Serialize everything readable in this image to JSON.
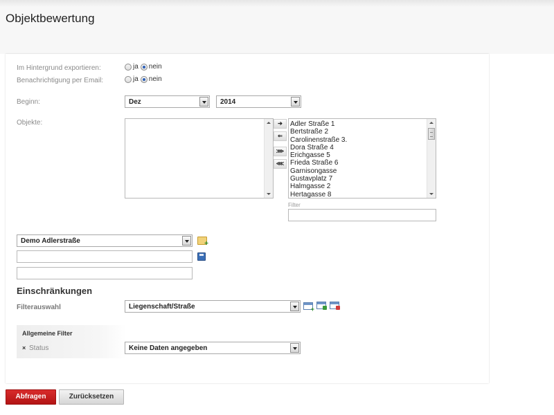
{
  "page": {
    "title": "Objektbewertung"
  },
  "export": {
    "background_label": "Im Hintergrund exportieren:",
    "email_label": "Benachrichtigung per Email:",
    "yes": "ja",
    "no": "nein",
    "background_value": "nein",
    "email_value": "nein"
  },
  "begin": {
    "label": "Beginn:",
    "month": "Dez",
    "year": "2014"
  },
  "objects": {
    "label": "Objekte:",
    "selected": [],
    "available": [
      "Adler Straße 1",
      "Bertstraße 2",
      "Carolinenstraße 3.",
      "Dora Straße 4",
      "Erichgasse 5",
      "Frieda Straße 6",
      "Garnisongasse",
      "Gustavplatz 7",
      "Halmgasse 2",
      "Hertagasse 8"
    ],
    "filter_label": "Filter",
    "filter_value": "",
    "buttons": {
      "add_one": "➔",
      "remove_one": "⇐",
      "add_all": "⋙",
      "remove_all": "⋘"
    }
  },
  "template": {
    "selected": "Demo Adlerstraße",
    "name_value": "",
    "description_value": ""
  },
  "restrictions": {
    "title": "Einschränkungen",
    "filter_select_label": "Filterauswahl",
    "filter_select_value": "Liegenschaft/Straße"
  },
  "general_filter": {
    "title": "Allgemeine Filter",
    "remove_icon": "×",
    "status_label": "Status",
    "status_value": "Keine Daten angegeben"
  },
  "actions": {
    "submit": "Abfragen",
    "reset": "Zurücksetzen"
  },
  "colors": {
    "primary_button": "#c21b1b",
    "radio_checked": "#2b5fb8"
  }
}
